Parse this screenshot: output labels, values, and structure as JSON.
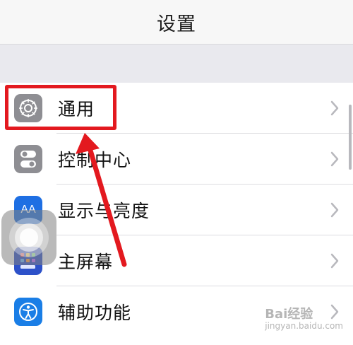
{
  "header": {
    "title": "设置"
  },
  "settings": {
    "items": [
      {
        "label": "通用",
        "icon": "gear-icon",
        "color": "#8e8e93"
      },
      {
        "label": "控制中心",
        "icon": "toggles-icon",
        "color": "#8e8e93"
      },
      {
        "label": "显示与亮度",
        "icon": "text-size-icon",
        "color": "#1e6fe3"
      },
      {
        "label": "主屏幕",
        "icon": "home-screen-icon",
        "color": "#2d51c9"
      },
      {
        "label": "辅助功能",
        "icon": "accessibility-icon",
        "color": "#1a7ee6"
      }
    ]
  },
  "text_size_glyph": "AA",
  "annotation": {
    "color": "#e3191f"
  },
  "watermark": {
    "text": "Bai经验",
    "sub": "jingyan.baidu.com"
  }
}
